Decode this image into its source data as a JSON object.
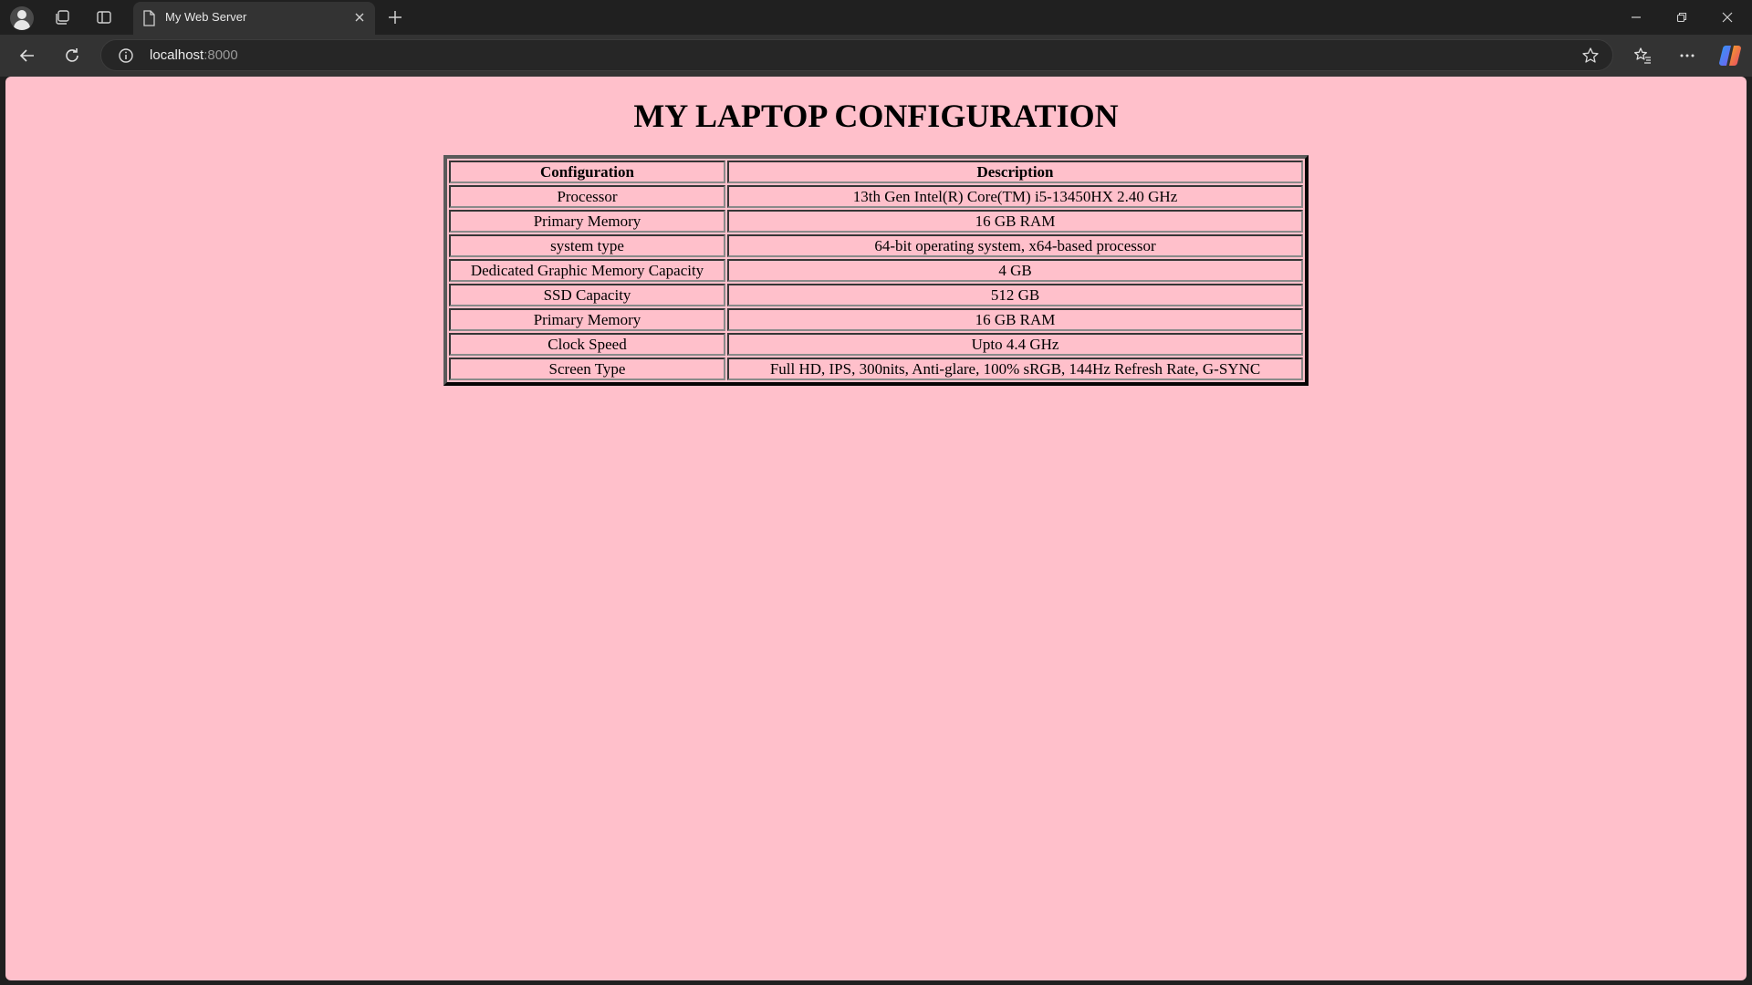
{
  "browser": {
    "tab": {
      "title": "My Web Server"
    },
    "address": {
      "host": "localhost",
      "port": ":8000"
    },
    "icons": {
      "profile": "profile-avatar-icon",
      "workspaces": "workspaces-icon",
      "tab_actions": "vertical-tabs-icon",
      "page": "page-document-icon",
      "close_tab": "close-icon",
      "new_tab": "plus-icon",
      "minimize": "minimize-icon",
      "restore": "restore-icon",
      "close_window": "close-icon",
      "back": "back-arrow-icon",
      "refresh": "refresh-icon",
      "site_info": "info-icon",
      "favorite": "star-icon",
      "favorites": "favorites-icon",
      "more": "more-icon",
      "copilot": "copilot-icon"
    }
  },
  "page": {
    "background": "#ffc0cb",
    "heading": "MY LAPTOP CONFIGURATION",
    "table": {
      "headers": [
        "Configuration",
        "Description"
      ],
      "rows": [
        [
          "Processor",
          "13th Gen Intel(R) Core(TM) i5-13450HX 2.40 GHz"
        ],
        [
          "Primary Memory",
          "16 GB RAM"
        ],
        [
          "system type",
          "64-bit operating system, x64-based processor"
        ],
        [
          "Dedicated Graphic Memory Capacity",
          "4 GB"
        ],
        [
          "SSD Capacity",
          "512 GB"
        ],
        [
          "Primary Memory",
          "16 GB RAM"
        ],
        [
          "Clock Speed",
          "Upto 4.4 GHz"
        ],
        [
          "Screen Type",
          "Full HD, IPS, 300nits, Anti-glare, 100% sRGB, 144Hz Refresh Rate, G-SYNC"
        ]
      ]
    }
  }
}
